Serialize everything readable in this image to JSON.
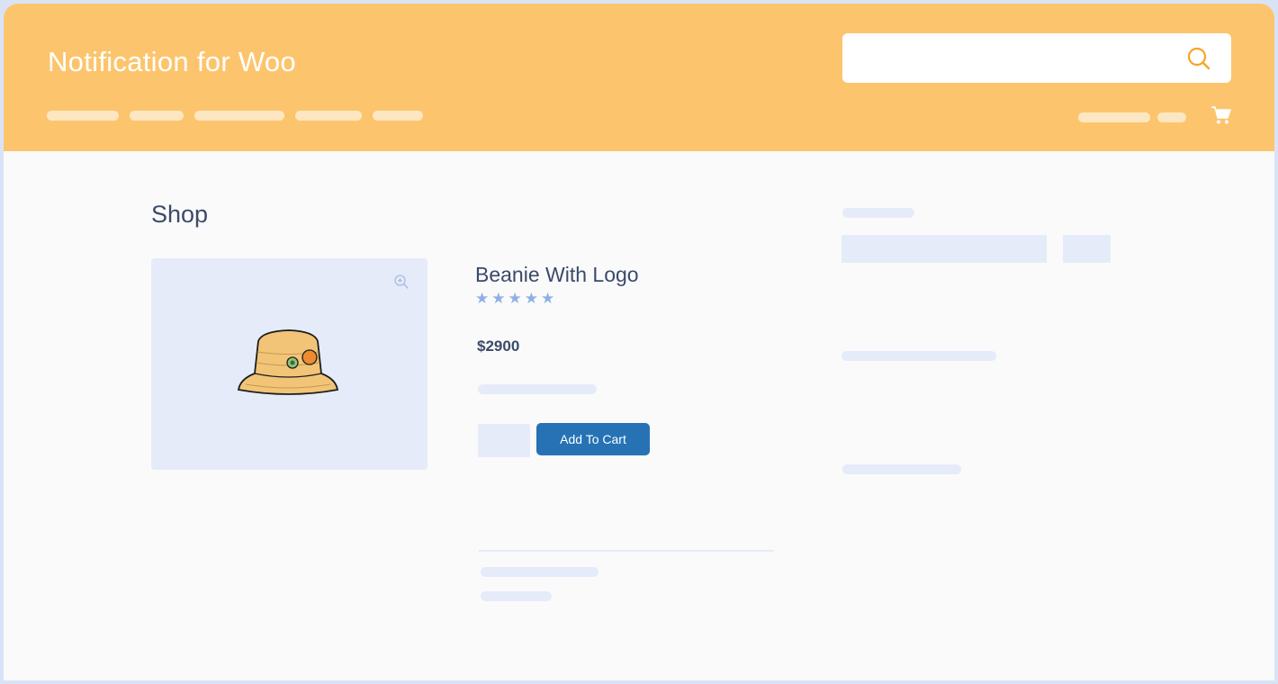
{
  "header": {
    "site_title": "Notification for Woo",
    "search": {
      "placeholder": "",
      "icon": "search-icon"
    },
    "cart_icon": "cart-icon"
  },
  "page": {
    "title": "Shop"
  },
  "product": {
    "name": "Beanie With Logo",
    "rating": "5",
    "price": "$2900",
    "add_to_cart_label": "Add To Cart"
  },
  "colors": {
    "header_bg": "#fcc56d",
    "accent": "#f5a623",
    "button": "#2672b5",
    "placeholder": "#e5ebf9",
    "text": "#3b4a6b"
  }
}
